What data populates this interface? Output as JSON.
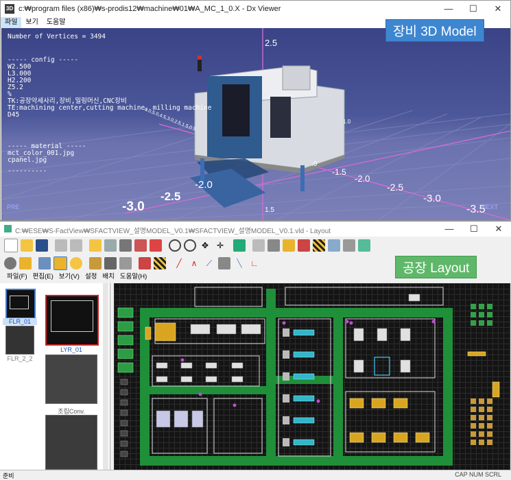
{
  "window1": {
    "title": "c:₩program files (x86)₩s-prodis12₩machine₩01₩A_MC_1_0.X - Dx Viewer",
    "app_icon": "3D",
    "controls": {
      "minimize": "—",
      "maximize": "☐",
      "close": "✕"
    },
    "menu": [
      "파일",
      "보기",
      "도움말"
    ],
    "badge": "장비 3D Model",
    "viewport": {
      "vertices": "Number of Vertices = 3494",
      "config_header": "----- config -----",
      "config_lines": [
        "W2.500",
        "L3.000",
        "H2.200",
        "Z5.2",
        "%",
        "TK:공장악세사리,장비,밀링머신,CNC장비",
        "TE:machining center,cutting machine, milling machine",
        "",
        "D45"
      ],
      "material_header": "----- material -----",
      "material_lines": [
        "mct_color_001.jpg",
        "cpanel.jpg",
        "",
        "----------"
      ],
      "axis_top": "2.5",
      "axis_labels_front": [
        "-3.0",
        "-2.5",
        "-2.0",
        "-1.5",
        "-1.0"
      ],
      "axis_labels_right": [
        "1.0",
        "1.5",
        "-2.0",
        "-2.5",
        "-3.0",
        "-3.5"
      ],
      "axis_vertical": [
        "2.0",
        "1.5",
        "1.0",
        ".0",
        "-1.5"
      ],
      "axis_left_row": "6.0,5.0,4.5,3.0,2.5,1.5,0.5",
      "axis_bottom": "1.5",
      "nav_prev": "PRE",
      "nav_next": "NEXT"
    }
  },
  "window2": {
    "title": "C:₩ESE₩S-FactView₩SFACTVIEW_설명MODEL_V0.1₩SFACTVIEW_설명MODEL_V0.1.vld - Layout",
    "controls": {
      "minimize": "—",
      "maximize": "☐",
      "close": "✕"
    },
    "menu": [
      "파일(F)",
      "편집(E)",
      "보기(V)",
      "설정",
      "배치",
      "도움말(H)"
    ],
    "badge": "공장 Layout",
    "toolbar1_icons": [
      "new-icon",
      "open-icon",
      "save-icon",
      "undo-icon",
      "redo-icon",
      "layer-icon",
      "layers-icon",
      "print-icon",
      "person-icon",
      "pen-icon",
      "zoom-in-icon",
      "zoom-out-icon",
      "move-icon",
      "pan-icon",
      "cube-icon",
      "machine-icon",
      "printer-icon",
      "forklift-icon",
      "worker-icon",
      "barrier-icon",
      "conveyor-icon",
      "robot-icon",
      "export-icon"
    ],
    "toolbar2_icons": [
      "camera-icon",
      "truck-icon",
      "rack-icon",
      "select-icon",
      "user-icon",
      "shelf-icon",
      "copier-icon",
      "tank-icon",
      "person2-icon",
      "barricade-icon",
      "measure-icon",
      "angle-icon",
      "line-icon",
      "tool-icon",
      "ruler-icon",
      "axis-icon"
    ],
    "floors": [
      {
        "label": "FLR_01",
        "selected": true
      },
      {
        "label": "FLR_2_2",
        "selected": false
      }
    ],
    "layers": [
      {
        "label": "LYR_01"
      },
      {
        "label": "조립Conv."
      },
      {
        "label": ""
      }
    ],
    "status_left": "준비",
    "status_right": "CAP  NUM  SCRL"
  },
  "colors": {
    "viewport_bg": "#4b5799",
    "badge_blue": "#3e86d0",
    "badge_green": "#5fb86a",
    "aisle": "#1f8f3a",
    "machine_teal": "#35b5c8"
  }
}
